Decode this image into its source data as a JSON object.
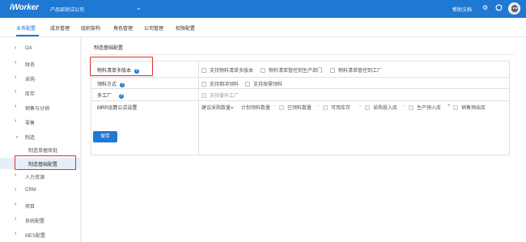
{
  "topbar": {
    "logo": "iWorker",
    "company": "产品部测试公司",
    "company_caret": "⌄",
    "help": "帮助文档",
    "icons": [
      "gear-icon",
      "chat-icon",
      "avatar"
    ]
  },
  "tabs": [
    {
      "label": "业务配置",
      "active": true
    },
    {
      "label": "成员管理",
      "active": false
    },
    {
      "label": "组织架构",
      "active": false
    },
    {
      "label": "角色管理",
      "active": false
    },
    {
      "label": "公司管理",
      "active": false
    },
    {
      "label": "权限配置",
      "active": false
    }
  ],
  "sidebar": {
    "items": [
      {
        "label": "OA",
        "chevron": "›"
      },
      {
        "label": "财务",
        "chevron": "›"
      },
      {
        "label": "采购",
        "chevron": "›"
      },
      {
        "label": "库存",
        "chevron": "›"
      },
      {
        "label": "销售与分销",
        "chevron": "›"
      },
      {
        "label": "零售",
        "chevron": "›"
      },
      {
        "label": "制造",
        "chevron": "⌄"
      },
      {
        "label": "人力资源",
        "chevron": "›"
      },
      {
        "label": "CRM",
        "chevron": "›"
      },
      {
        "label": "项目",
        "chevron": "›"
      },
      {
        "label": "系统配置",
        "chevron": "›"
      },
      {
        "label": "MES配置",
        "chevron": "›"
      }
    ],
    "subitems": [
      {
        "label": "制造单据审批",
        "active": false
      },
      {
        "label": "制造基础配置",
        "active": true
      }
    ]
  },
  "main": {
    "title": "制造基础配置",
    "rows": [
      {
        "label": "物料清单多版本",
        "has_help": true,
        "options": [
          "支持物料清单多版本",
          "物料清单管控到生产部门",
          "物料清单管控到工厂"
        ]
      },
      {
        "label": "领料方式",
        "has_help": true,
        "options": [
          "支持倒冲领料",
          "支持按需领料"
        ]
      },
      {
        "label": "多工厂",
        "has_help": true,
        "options": [
          "支持委外工厂"
        ]
      },
      {
        "label": "MRP运算公式设置",
        "has_help": false,
        "formula": {
          "prefix": "建议采购数量=",
          "base": "计划领料数量",
          "terms": [
            {
              "op": "-",
              "label": "已领料数量"
            },
            {
              "op": "-",
              "label": "可用库存"
            },
            {
              "op": "-",
              "label": "采购投入库"
            },
            {
              "op": "-",
              "label": "生产预入库"
            },
            {
              "op": "+",
              "label": "销售预出库"
            }
          ]
        }
      }
    ],
    "save_label": "保存"
  },
  "colors": {
    "brand": "#1f78d1",
    "highlight": "#e0322f"
  }
}
